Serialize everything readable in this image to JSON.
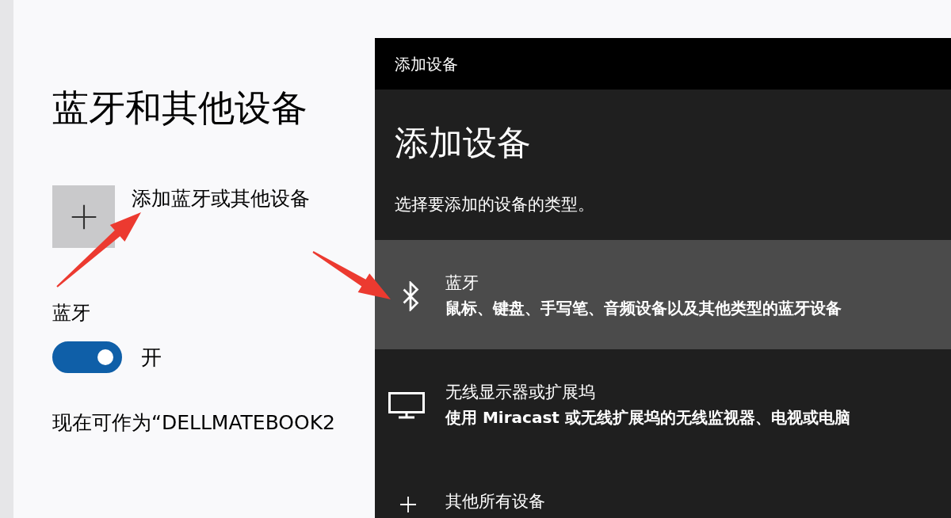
{
  "settings_page": {
    "title": "蓝牙和其他设备",
    "add_button": {
      "label": "添加蓝牙或其他设备"
    },
    "bluetooth": {
      "label": "蓝牙",
      "on": true,
      "state_text": "开"
    },
    "discoverable_text": "现在可作为“DELLMATEBOOK2"
  },
  "dialog": {
    "window_title": "添加设备",
    "heading": "添加设备",
    "subtitle": "选择要添加的设备的类型。",
    "options": [
      {
        "kind": "bluetooth",
        "title": "蓝牙",
        "description": "鼠标、键盘、手写笔、音频设备以及其他类型的蓝牙设备",
        "selected": true
      },
      {
        "kind": "display",
        "title": "无线显示器或扩展坞",
        "description": "使用 Miracast 或无线扩展坞的无线监视器、电视或电脑",
        "selected": false
      },
      {
        "kind": "other",
        "title": "其他所有设备",
        "selected": false
      }
    ]
  }
}
